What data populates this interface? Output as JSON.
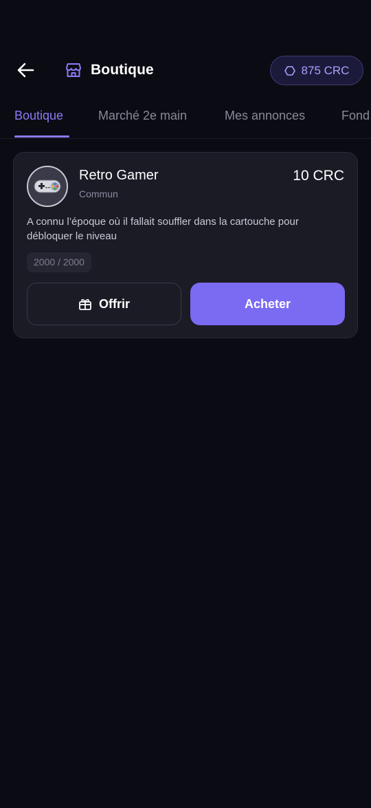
{
  "header": {
    "title": "Boutique",
    "balance": "875 CRC"
  },
  "tabs": [
    {
      "label": "Boutique",
      "active": true
    },
    {
      "label": "Marché 2e main",
      "active": false
    },
    {
      "label": "Mes annonces",
      "active": false
    },
    {
      "label": "Fond",
      "active": false
    }
  ],
  "item": {
    "name": "Retro Gamer",
    "rarity": "Commun",
    "price": "10 CRC",
    "description": "A connu l’époque où il fallait souffler dans la cartouche pour débloquer le niveau",
    "stock": "2000 / 2000",
    "icon": "gamepad-icon"
  },
  "actions": {
    "offer_label": "Offrir",
    "buy_label": "Acheter"
  },
  "colors": {
    "background": "#0b0b14",
    "accent": "#7b6af2",
    "accent_text": "#8b7cf6",
    "card": "#1b1b26"
  }
}
